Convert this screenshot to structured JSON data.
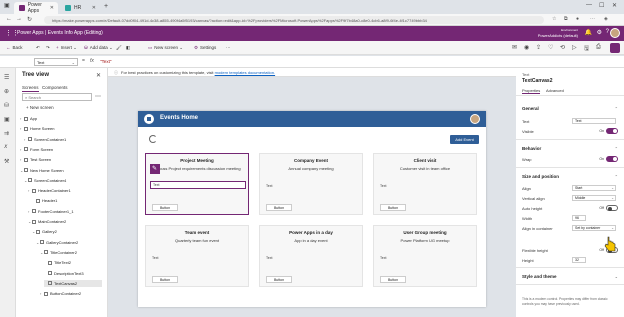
{
  "browser": {
    "tabs": [
      {
        "label": "Power Apps",
        "active": true
      },
      {
        "label": "HR",
        "active": false
      }
    ],
    "url": "https://make.powerapps.com/e/Default-07dd0f04-491d-4c38-a855-490f4a5f5193/canvas/?action=edit&app-id=%2Fproviders%2FMicrosoft.PowerApps%2Fapps%2F9f7b48a0-c8e0-4cb6-a8f9-6f4e-4f1c7749bbb34"
  },
  "app": {
    "name": "Power Apps",
    "title": "Power Apps  |  Events Info App (Editing)",
    "environment_label": "Environment",
    "environment": "PowerAddicts (default)"
  },
  "commandbar": {
    "back": "Back",
    "insert": "Insert",
    "add_data": "Add data",
    "new_screen": "New screen",
    "settings": "Settings"
  },
  "formula": {
    "property": "Text",
    "value": "\"Text\""
  },
  "tree": {
    "title": "Tree view",
    "tabs": [
      "Screens",
      "Components"
    ],
    "search_placeholder": "Search",
    "new_screen": "New screen",
    "nodes": [
      {
        "label": "App",
        "indent": 0,
        "chev": "›",
        "selected": false
      },
      {
        "label": "Home Screen",
        "indent": 0,
        "chev": "›",
        "selected": false
      },
      {
        "label": "ScreenContainer1",
        "indent": 1,
        "chev": "›",
        "selected": false
      },
      {
        "label": "Form Screen",
        "indent": 0,
        "chev": "›",
        "selected": false
      },
      {
        "label": "Test Screen",
        "indent": 0,
        "chev": "›",
        "selected": false
      },
      {
        "label": "New Home Screen",
        "indent": 0,
        "chev": "⌄",
        "selected": false
      },
      {
        "label": "ScreenContainer4",
        "indent": 1,
        "chev": "⌄",
        "selected": false
      },
      {
        "label": "HeaderContainer1",
        "indent": 2,
        "chev": "›",
        "selected": false
      },
      {
        "label": "Header1",
        "indent": 3,
        "chev": "",
        "selected": false
      },
      {
        "label": "FooterContainer1_1",
        "indent": 2,
        "chev": "›",
        "selected": false
      },
      {
        "label": "MainContainer2",
        "indent": 2,
        "chev": "⌄",
        "selected": false
      },
      {
        "label": "Gallery2",
        "indent": 3,
        "chev": "⌄",
        "selected": false
      },
      {
        "label": "GalleryContainer2",
        "indent": 4,
        "chev": "⌄",
        "selected": false
      },
      {
        "label": "TitleContainer2",
        "indent": 5,
        "chev": "⌄",
        "selected": false
      },
      {
        "label": "TitleText2",
        "indent": 6,
        "chev": "",
        "selected": false
      },
      {
        "label": "DescriptionText3",
        "indent": 6,
        "chev": "",
        "selected": false
      },
      {
        "label": "TextCanvas2",
        "indent": 6,
        "chev": "",
        "selected": true
      },
      {
        "label": "ButtonContainer2",
        "indent": 5,
        "chev": "›",
        "selected": false
      }
    ]
  },
  "infobar": {
    "text": "For best practices on customizing this template, visit",
    "link": "modern templates documentation."
  },
  "screen": {
    "title": "Events Home",
    "add_event": "Add Event",
    "cards": [
      {
        "title": "Project Meeting",
        "desc": "Discuss Project requirements discussion meeting",
        "text": "Text",
        "button": "Button",
        "selected": true
      },
      {
        "title": "Company Event",
        "desc": "Annual company meeting",
        "text": "Text",
        "button": "Button",
        "selected": false
      },
      {
        "title": "Client visit",
        "desc": "Customer visit in team office",
        "text": "Text",
        "button": "Button",
        "selected": false
      },
      {
        "title": "Team event",
        "desc": "Quarterly team fun event",
        "text": "Text",
        "button": "Button",
        "selected": false
      },
      {
        "title": "Power Apps in a day",
        "desc": "App in a day event",
        "text": "Text",
        "button": "Button",
        "selected": false
      },
      {
        "title": "User Group meeting",
        "desc": "Power Platform UG meetup",
        "text": "Text",
        "button": "Button",
        "selected": false
      }
    ]
  },
  "properties": {
    "type": "Text",
    "name": "TextCanvas2",
    "tabs": [
      "Properties",
      "Advanced"
    ],
    "general": "General",
    "text_label": "Text",
    "text_value": "Text",
    "visible_label": "Visible",
    "visible_state": "On",
    "behavior": "Behavior",
    "wrap_label": "Wrap",
    "wrap_state": "On",
    "size_position": "Size and position",
    "align_label": "Align",
    "align_value": "Start",
    "valign_label": "Vertical align",
    "valign_value": "Middle",
    "autoheight_label": "Auto height",
    "autoheight_state": "Off",
    "width_label": "Width",
    "width_value": "96",
    "align_container_label": "Align in container",
    "align_container_value": "Set by container",
    "flexheight_label": "Flexible height",
    "flexheight_state": "Off",
    "height_label": "Height",
    "height_value": "32",
    "style_theme": "Style and theme",
    "note": "This is a modern control. Properties may differ from classic controls you may have previously used."
  },
  "colors": {
    "brand": "#742774",
    "screen_header": "#2f5e97"
  }
}
